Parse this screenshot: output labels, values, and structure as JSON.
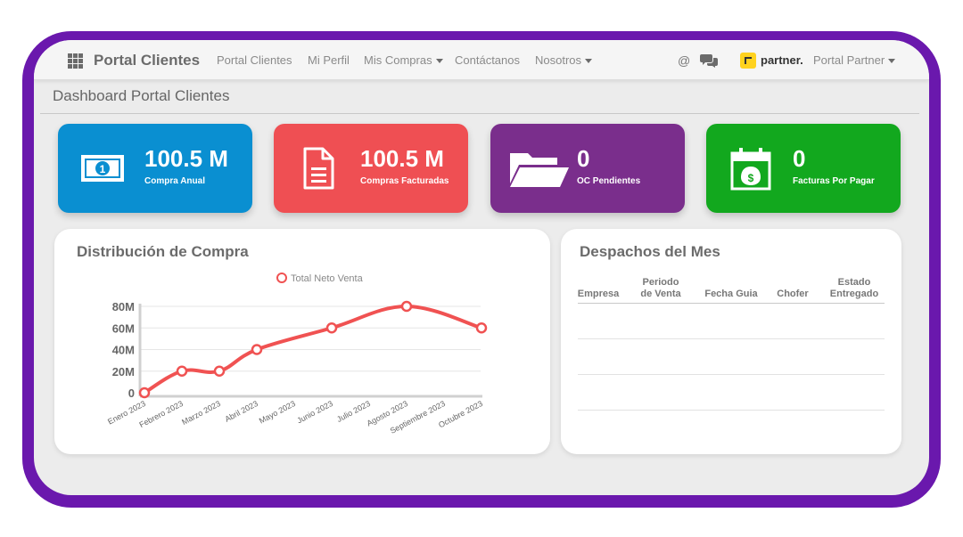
{
  "nav": {
    "brand": "Portal Clientes",
    "links": [
      "Portal Clientes",
      "Mi Perfil",
      "Mis Compras",
      "Contáctanos",
      "Nosotros"
    ],
    "partner_logo_text": "partner.",
    "user_menu": "Portal Partner"
  },
  "page_title": "Dashboard Portal Clientes",
  "kpis": [
    {
      "value": "100.5 M",
      "label": "Compra Anual",
      "color": "#0a8fd1",
      "icon": "money-icon"
    },
    {
      "value": "100.5 M",
      "label": "Compras Facturadas",
      "color": "#ef4f53",
      "icon": "document-icon"
    },
    {
      "value": "0",
      "label": "OC Pendientes",
      "color": "#7a2e8c",
      "icon": "folder-icon"
    },
    {
      "value": "0",
      "label": "Facturas Por Pagar",
      "color": "#12a81e",
      "icon": "calendar-money-icon"
    }
  ],
  "distribution": {
    "title": "Distribución de Compra"
  },
  "chart_data": {
    "type": "line",
    "title": "",
    "xlabel": "",
    "ylabel": "",
    "categories": [
      "Enero 2023",
      "Febrero 2023",
      "Marzo 2023",
      "Abril 2023",
      "Mayo 2023",
      "Junio 2023",
      "Julio 2023",
      "Agosto 2023",
      "Septiembre 2023",
      "Octubre 2023"
    ],
    "series": [
      {
        "name": "Total Neto Venta",
        "values": [
          0,
          20,
          20,
          40,
          null,
          60,
          null,
          80,
          null,
          60
        ],
        "color": "#f05252"
      }
    ],
    "ylim": [
      0,
      80
    ],
    "yticks": [
      "0",
      "20M",
      "40M",
      "60M",
      "80M"
    ],
    "legend_position": "top-center",
    "grid": true
  },
  "despachos": {
    "title": "Despachos del Mes",
    "columns": [
      "Empresa",
      "Periodo de Venta",
      "Fecha Guia",
      "Chofer",
      "Estado Entregado"
    ]
  }
}
